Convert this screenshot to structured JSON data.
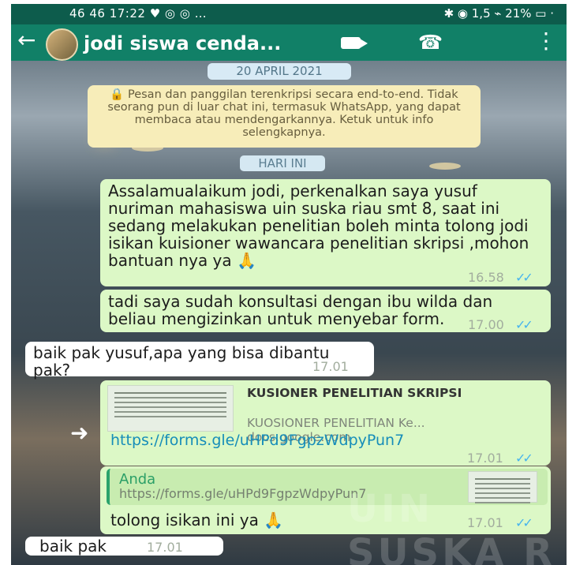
{
  "status_bar": {
    "left": "46 46 17:22 ♥ ◎ ◎ …",
    "right": "✱ ◉ 1,5 ⌁ 21% ▭ ·"
  },
  "app_bar": {
    "back_icon": "arrow-left-icon",
    "title": "jodi siswa cenda...",
    "video_icon": "video-call-icon",
    "call_icon": "phone-icon",
    "menu_icon": "more-vertical-icon"
  },
  "chat": {
    "date": "20 APRIL 2021",
    "encryption_notice": "🔒 Pesan dan panggilan terenkripsi secara end-to-end. Tidak seorang pun di luar chat ini, termasuk WhatsApp, yang dapat membaca atau mendengarkannya. Ketuk untuk info selengkapnya.",
    "today": "HARI INI",
    "messages": [
      {
        "type": "outgoing",
        "text": "Assalamualaikum jodi, perkenalkan saya yusuf nuriman mahasiswa uin suska riau smt 8, saat ini sedang melakukan penelitian boleh minta tolong jodi isikan kuisioner wawancara penelitian skripsi ,mohon bantuan nya ya",
        "emoji": "🙏",
        "time": "16.58",
        "ticks": "✓✓"
      },
      {
        "type": "outgoing",
        "text": "tadi saya sudah konsultasi dengan ibu wilda dan beliau mengizinkan untuk menyebar form.",
        "time": "17.00",
        "ticks": "✓✓"
      },
      {
        "type": "incoming",
        "text": "baik pak yusuf,apa yang bisa dibantu pak?",
        "time": "17.01"
      },
      {
        "type": "outgoing-link",
        "link_title": "KUSIONER PENELITIAN SKRIPSI",
        "link_description": "KUOSIONER PENELITIAN Ke...",
        "link_domain": "docs.google.com",
        "url": "https://forms.gle/uHPd9FgpzWdpyPun7",
        "time": "17.01",
        "ticks": "✓✓"
      },
      {
        "type": "outgoing-reply",
        "quote_author": "Anda",
        "quote_text": "https://forms.gle/uHPd9FgpzWdpyPun7",
        "text": "tolong isikan ini ya",
        "emoji": "🙏",
        "time": "17.01",
        "ticks": "✓✓"
      },
      {
        "type": "incoming",
        "text": "baik pak",
        "time": "17.01"
      }
    ]
  },
  "decorations": {
    "share_icon": "forward-arrow-icon",
    "watermark": "UIN SUSKA R"
  },
  "colors": {
    "app_bar": "#118067",
    "outgoing_bubble": "#dcf8c6",
    "incoming_bubble": "#ffffff",
    "link": "#168db9",
    "read_ticks": "#47b4ee"
  }
}
